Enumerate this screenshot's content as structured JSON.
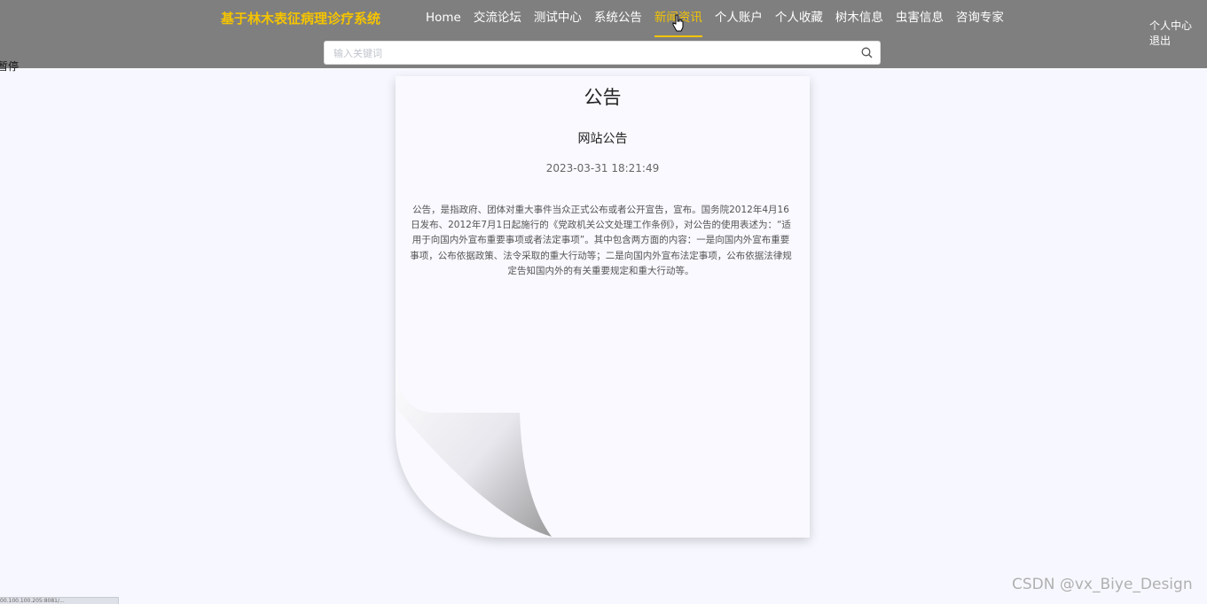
{
  "header": {
    "brand": "基于林木表征病理诊疗系统",
    "nav": [
      {
        "label": "Home",
        "active": false
      },
      {
        "label": "交流论坛",
        "active": false
      },
      {
        "label": "测试中心",
        "active": false
      },
      {
        "label": "系统公告",
        "active": false
      },
      {
        "label": "新闻资讯",
        "active": true
      },
      {
        "label": "个人账户",
        "active": false
      },
      {
        "label": "个人收藏",
        "active": false
      },
      {
        "label": "树木信息",
        "active": false
      },
      {
        "label": "虫害信息",
        "active": false
      },
      {
        "label": "咨询专家",
        "active": false
      }
    ],
    "search": {
      "placeholder": "输入关键词",
      "value": ""
    },
    "user_links": {
      "center": "个人中心",
      "logout": "退出"
    },
    "stray_text": "暂停"
  },
  "notice": {
    "heading": "公告",
    "title": "网站公告",
    "time": "2023-03-31 18:21:49",
    "content": "公告，是指政府、团体对重大事件当众正式公布或者公开宣告，宣布。国务院2012年4月16日发布、2012年7月1日起施行的《党政机关公文处理工作条例》，对公告的使用表述为：“适用于向国内外宣布重要事项或者法定事项”。其中包含两方面的内容：一是向国内外宣布重要事项，公布依据政策、法令采取的重大行动等；二是向国内外宣布法定事项，公布依据法律规定告知国内外的有关重要规定和重大行动等。"
  },
  "watermark": "CSDN @vx_Biye_Design",
  "status_url": "00.100.100.205:8081/...",
  "colors": {
    "header_bg": "#7f7f7f",
    "accent": "#f5c400",
    "page_bg": "#f7f8ff"
  }
}
